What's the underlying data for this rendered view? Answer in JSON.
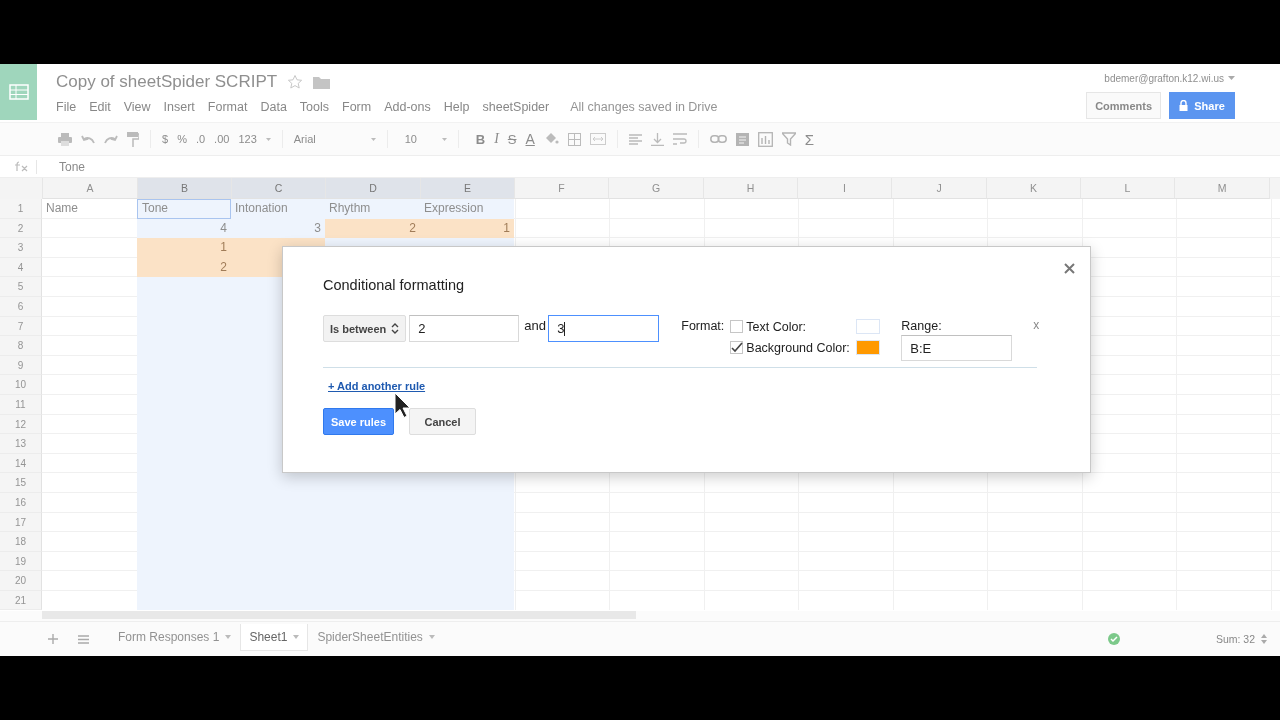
{
  "app": {
    "title": "Copy of sheetSpider SCRIPT",
    "user": "bdemer@grafton.k12.wi.us",
    "save_status": "All changes saved in Drive",
    "buttons": [
      "Comments",
      "Share"
    ]
  },
  "menu": [
    "File",
    "Edit",
    "View",
    "Insert",
    "Format",
    "Data",
    "Tools",
    "Form",
    "Add-ons",
    "Help",
    "sheetSpider"
  ],
  "toolbar": {
    "number_formats": [
      "$",
      "%",
      ".0",
      ".00",
      "123"
    ],
    "font": "Arial",
    "font_size": "10",
    "text_styles": [
      "B",
      "I",
      "S",
      "A"
    ],
    "functions": "Σ"
  },
  "formula_bar": {
    "value": "Tone"
  },
  "sheet": {
    "columns": [
      {
        "label": "A",
        "selected": false
      },
      {
        "label": "B",
        "selected": true
      },
      {
        "label": "C",
        "selected": true
      },
      {
        "label": "D",
        "selected": true
      },
      {
        "label": "E",
        "selected": true
      },
      {
        "label": "F",
        "selected": false
      },
      {
        "label": "G",
        "selected": false
      },
      {
        "label": "H",
        "selected": false
      },
      {
        "label": "I",
        "selected": false
      },
      {
        "label": "J",
        "selected": false
      },
      {
        "label": "K",
        "selected": false
      },
      {
        "label": "L",
        "selected": false
      },
      {
        "label": "M",
        "selected": false
      }
    ],
    "rows": [
      {
        "number": "1",
        "cells": [
          {
            "text": "Name",
            "highlighted": false,
            "kind": "text"
          },
          {
            "text": "Tone",
            "highlighted": false,
            "kind": "text",
            "active": true
          },
          {
            "text": "Intonation",
            "highlighted": false,
            "kind": "text"
          },
          {
            "text": "Rhythm",
            "highlighted": false,
            "kind": "text"
          },
          {
            "text": "Expression",
            "highlighted": false,
            "kind": "text"
          }
        ]
      },
      {
        "number": "2",
        "cells": [
          {
            "highlighted": false
          },
          {
            "text": "4",
            "highlighted": false,
            "kind": "number"
          },
          {
            "text": "3",
            "highlighted": false,
            "kind": "number"
          },
          {
            "text": "2",
            "highlighted": true,
            "kind": "number"
          },
          {
            "text": "1",
            "highlighted": true,
            "kind": "number"
          }
        ]
      },
      {
        "number": "3",
        "cells": [
          {
            "highlighted": false
          },
          {
            "text": "1",
            "highlighted": true,
            "kind": "number"
          },
          {
            "highlighted": true
          }
        ]
      },
      {
        "number": "4",
        "cells": [
          {
            "highlighted": false
          },
          {
            "text": "2",
            "highlighted": true,
            "kind": "number"
          },
          {
            "highlighted": true
          }
        ]
      },
      {
        "number": "5"
      },
      {
        "number": "6"
      },
      {
        "number": "7"
      },
      {
        "number": "8"
      },
      {
        "number": "9"
      },
      {
        "number": "10"
      },
      {
        "number": "11"
      },
      {
        "number": "12"
      },
      {
        "number": "13"
      },
      {
        "number": "14"
      },
      {
        "number": "15"
      },
      {
        "number": "16"
      },
      {
        "number": "17"
      },
      {
        "number": "18"
      },
      {
        "number": "19"
      },
      {
        "number": "20"
      },
      {
        "number": "21"
      }
    ]
  },
  "sheet_tabs": [
    {
      "label": "Form Responses 1",
      "selected": false
    },
    {
      "label": "Sheet1",
      "selected": true
    },
    {
      "label": "SpiderSheetEntities",
      "selected": false
    }
  ],
  "status": {
    "sum": "Sum: 32"
  },
  "dialog": {
    "title": "Conditional formatting",
    "rule": {
      "condition": "Is between",
      "value_1": "2",
      "joiner": "and",
      "value_2": "3",
      "format_label": "Format:",
      "formats": [
        {
          "label": "Text Color:",
          "checked": false,
          "color": "#ffffff"
        },
        {
          "label": "Background Color:",
          "checked": true,
          "color": "#ff9900"
        }
      ],
      "range_label": "Range:",
      "range": "B:E",
      "remove": "x"
    },
    "add_rule": "+ Add another rule",
    "buttons": [
      "Save rules",
      "Cancel"
    ]
  }
}
